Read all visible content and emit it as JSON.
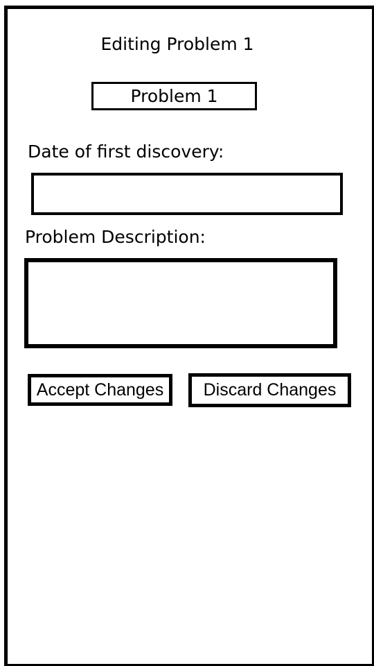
{
  "header": {
    "title": "Editing Problem 1",
    "problem_name": "Problem 1"
  },
  "form": {
    "date_label": "Date of first discovery:",
    "date_value": "",
    "description_label": "Problem Description:",
    "description_value": ""
  },
  "actions": {
    "accept_label": "Accept Changes",
    "discard_label": "Discard Changes"
  }
}
